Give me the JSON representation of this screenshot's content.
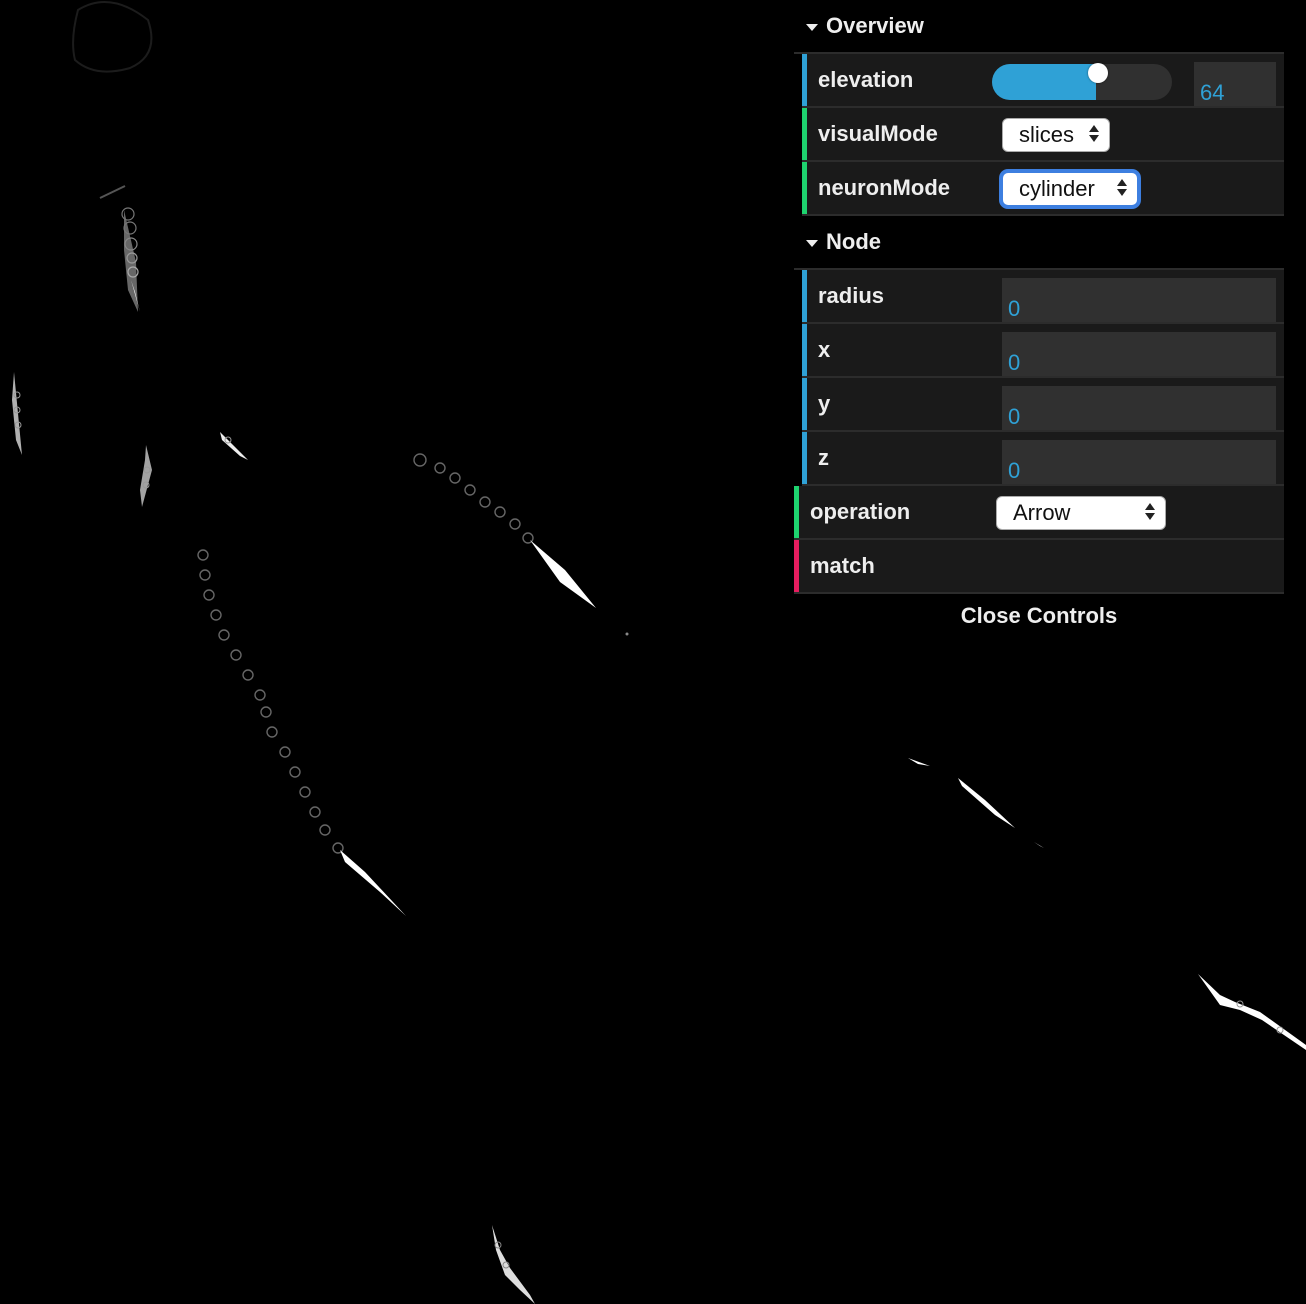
{
  "controls": {
    "overview": {
      "title": "Overview",
      "elevation": {
        "label": "elevation",
        "value": "64",
        "fraction": 0.58
      },
      "visualMode": {
        "label": "visualMode",
        "selected": "slices"
      },
      "neuronMode": {
        "label": "neuronMode",
        "selected": "cylinder"
      }
    },
    "node": {
      "title": "Node",
      "radius": {
        "label": "radius",
        "value": "0"
      },
      "x": {
        "label": "x",
        "value": "0"
      },
      "y": {
        "label": "y",
        "value": "0"
      },
      "z": {
        "label": "z",
        "value": "0"
      }
    },
    "operation": {
      "label": "operation",
      "selected": "Arrow"
    },
    "match": {
      "label": "match"
    },
    "close_label": "Close Controls"
  },
  "colors": {
    "number": "#2fa1d6",
    "boolean_accent": "#1ed36f",
    "function_accent": "#e61d5f",
    "background": "#000000"
  }
}
